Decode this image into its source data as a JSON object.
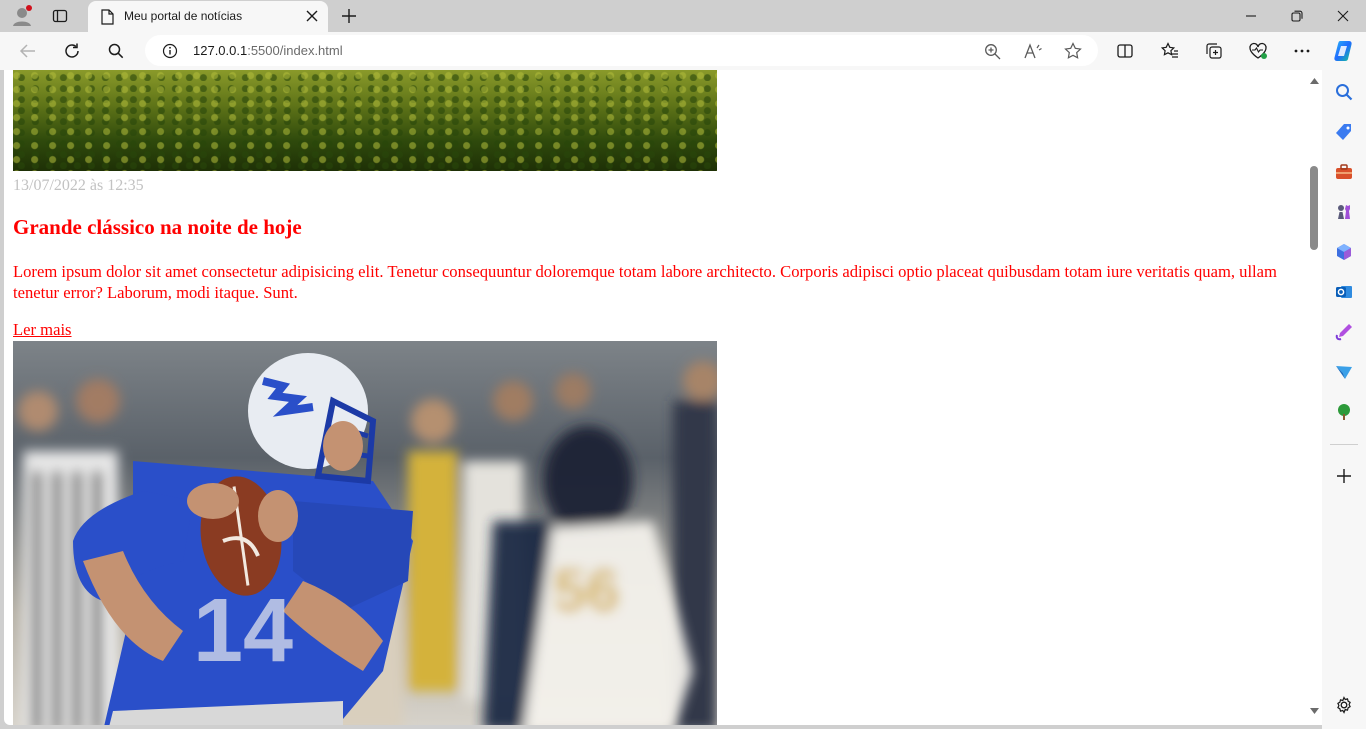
{
  "tab": {
    "title": "Meu portal de notícias"
  },
  "address": {
    "host": "127.0.0.1",
    "path": ":5500/index.html"
  },
  "article": {
    "date": "13/07/2022 às 12:35",
    "headline": "Grande clássico na noite de hoje",
    "body": "Lorem ipsum dolor sit amet consectetur adipisicing elit. Tenetur consequuntur doloremque totam labore architecto. Corporis adipisci optio placeat quibusdam totam iure veritatis quam, ullam tenetur error? Laborum, modi itaque. Sunt.",
    "read_more": "Ler mais"
  },
  "player_jersey_number": "14",
  "opponent_jersey_number": "56",
  "colors": {
    "accent": "#ff0000",
    "date": "#c2c2c2",
    "chrome": "#cfcfcf"
  },
  "icons": {
    "tabstrip": [
      "profile-icon",
      "tab-actions-icon",
      "page-icon",
      "close-icon",
      "new-tab-icon"
    ],
    "window": [
      "minimize-icon",
      "restore-icon",
      "close-window-icon"
    ],
    "toolbar": [
      "back-icon",
      "refresh-icon",
      "search-icon",
      "info-icon",
      "zoom-icon",
      "read-aloud-icon",
      "favorite-star-icon",
      "split-screen-icon",
      "favorites-icon",
      "collections-icon",
      "browser-essentials-icon",
      "more-icon",
      "copilot-icon"
    ],
    "sidebar": [
      "search-icon",
      "shopping-tag-icon",
      "tools-briefcase-icon",
      "games-chess-icon",
      "microsoft365-icon",
      "outlook-icon",
      "designer-icon",
      "send-icon",
      "tree-icon",
      "add-icon",
      "settings-gear-icon"
    ]
  }
}
